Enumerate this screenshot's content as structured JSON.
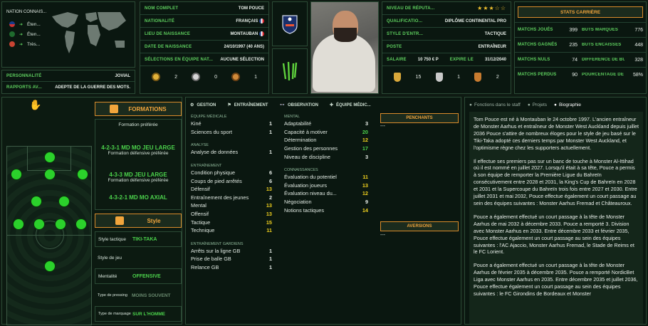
{
  "known_nationalities": {
    "header": "NATION  CONNAIS...",
    "items": [
      {
        "flag": "us",
        "label": "Éten..."
      },
      {
        "flag": "sa",
        "label": "Éten..."
      },
      {
        "flag": "other",
        "label": "Très..."
      }
    ]
  },
  "personality": {
    "label": "PERSONNALITÉ",
    "value": "JOVIAL"
  },
  "media": {
    "label": "RAPPORTS AV...",
    "value": "ADEPTE DE LA GUERRE DES MOTS."
  },
  "profile": {
    "full_name": {
      "label": "NOM COMPLET",
      "value": "TOM POUCE"
    },
    "nationality": {
      "label": "NATIONALITÉ",
      "value": "FRANÇAIS"
    },
    "birthplace": {
      "label": "LIEU DE NAISSANCE",
      "value": "MONTAUBAN"
    },
    "birthdate": {
      "label": "DATE DE NAISSANCE",
      "value": "24/10/1997 (40 ANS)"
    },
    "caps": {
      "label": "SÉLECTIONS EN ÉQUIPE NAT...",
      "value": "AUCUNE SÉLECTION"
    },
    "medals": [
      "2",
      "0",
      "1"
    ]
  },
  "reputation": {
    "level": {
      "label": "NIVEAU DE RÉPUTA...",
      "stars": "★★★☆☆"
    },
    "qualification": {
      "label": "QUALIFICATIO...",
      "value": "DIPLÔME CONTINENTAL PRO"
    },
    "style": {
      "label": "STYLE D'ENTR...",
      "value": "TACTIQUE"
    },
    "position": {
      "label": "POSTE",
      "value": "ENTRAÎNEUR"
    },
    "salary": {
      "label": "SALAIRE",
      "value": "10 750 € P",
      "expiry_label": "EXPIRE LE",
      "expiry": "31/12/2040"
    },
    "trophies": [
      "15",
      "1",
      "2"
    ]
  },
  "career": {
    "title": "STATS CARRIÈRE",
    "rows": [
      {
        "l1": "MATCHS JOUÉS",
        "v1": "399",
        "l2": "BUTS MARQUÉS",
        "v2": "776"
      },
      {
        "l1": "MATCHS GAGNÉS",
        "v1": "235",
        "l2": "BUTS ENCAISSÉS",
        "v2": "448"
      },
      {
        "l1": "MATCHS NULS",
        "v1": "74",
        "l2": "DIFFÉRENCE DE BU...",
        "v2": "328"
      },
      {
        "l1": "MATCHS PERDUS",
        "v1": "90",
        "l2": "POURCENTAGE DE ...",
        "v2": "58%"
      }
    ]
  },
  "formations": {
    "title": "FORMATIONS",
    "preferred_label": "Formation préférée",
    "f1": "4-2-3-1 MD MO JEU LARGE",
    "f1_sub": "Formation défensive préférée",
    "f2": "4-3-3 MD JEU LARGE",
    "f2_sub": "Formation défensive préférée",
    "f3": "4-3-2-1 MD MO AXIAL"
  },
  "style": {
    "title": "Style",
    "tactical_label": "Style tactique",
    "tactical": "TIKI-TAKA",
    "play_label": "Style de jeu",
    "mentality_label": "Mentalité",
    "mentality": "OFFENSIVE",
    "pressing_label": "Type de pressing",
    "pressing": "MOINS SOUVENT",
    "marking_label": "Type de marquage",
    "marking": "SUR L'HOMME"
  },
  "attr_tabs": [
    "GESTION",
    "ENTRAÎNEMENT",
    "OBSERVATION",
    "ÉQUIPE MÉDIC..."
  ],
  "attributes": {
    "medical": {
      "title": "ÉQUIPE MÉDICALE",
      "items": [
        {
          "n": "Kiné",
          "v": "1",
          "c": "w"
        },
        {
          "n": "Sciences du sport",
          "v": "1",
          "c": "w"
        }
      ]
    },
    "analysis": {
      "title": "ANALYSE",
      "items": [
        {
          "n": "Analyse de données",
          "v": "1",
          "c": "w"
        }
      ]
    },
    "coaching": {
      "title": "ENTRAÎNEMENT",
      "items": [
        {
          "n": "Condition physique",
          "v": "6",
          "c": "w"
        },
        {
          "n": "Coups de pied arrêtés",
          "v": "6",
          "c": "w"
        },
        {
          "n": "Défensif",
          "v": "13",
          "c": "y"
        },
        {
          "n": "Entraînement des jeunes",
          "v": "2",
          "c": "w"
        },
        {
          "n": "Mental",
          "v": "13",
          "c": "y"
        },
        {
          "n": "Offensif",
          "v": "13",
          "c": "y"
        },
        {
          "n": "Tactique",
          "v": "15",
          "c": "y"
        },
        {
          "n": "Technique",
          "v": "11",
          "c": "y"
        }
      ]
    },
    "gk": {
      "title": "ENTRAÎNEMENT GARDIENS",
      "items": [
        {
          "n": "Arrêts sur la ligne GB",
          "v": "1",
          "c": "w"
        },
        {
          "n": "Prise de balle GB",
          "v": "1",
          "c": "w"
        },
        {
          "n": "Relance GB",
          "v": "1",
          "c": "w"
        }
      ]
    },
    "mental": {
      "title": "MENTAL",
      "items": [
        {
          "n": "Adaptabilité",
          "v": "3",
          "c": "w"
        },
        {
          "n": "Capacité à motiver",
          "v": "20",
          "c": "g"
        },
        {
          "n": "Détermination",
          "v": "12",
          "c": "y"
        },
        {
          "n": "Gestion des personnes",
          "v": "17",
          "c": "g"
        },
        {
          "n": "Niveau de discipline",
          "v": "3",
          "c": "w"
        }
      ]
    },
    "knowledge": {
      "title": "CONNAISSANCES",
      "items": [
        {
          "n": "Évaluation du potentiel",
          "v": "11",
          "c": "y"
        },
        {
          "n": "Évaluation joueurs",
          "v": "13",
          "c": "y"
        },
        {
          "n": "Évaluation niveau du...",
          "v": "12",
          "c": "y"
        },
        {
          "n": "Négociation",
          "v": "9",
          "c": "w"
        },
        {
          "n": "Notions tactiques",
          "v": "14",
          "c": "y"
        }
      ]
    }
  },
  "likes": {
    "title": "PENCHANTS",
    "value": "---"
  },
  "dislikes": {
    "title": "AVERSIONS",
    "value": "---"
  },
  "bio_tabs": [
    "Fonctions dans le staff",
    "Projets",
    "Biographie"
  ],
  "bio": [
    "Tom Pouce est né à Montauban le 24 octobre 1997. L'ancien entraîneur de Monster Aarhus et entraîneur de Monster West Auckland depuis juillet 2036 Pouce s'attire de nombreux éloges pour le style de jeu basé sur le Tiki-Taka adopté ces derniers temps par Monster West Auckland, et l'optimisme règne chez les supporters actuellement.",
    "Il effectue ses premiers pas sur un banc de touche à Monster Al-Ittihad où il est nommé en juillet 2027. Lorsqu'il était à sa tête, Pouce a permis à son équipe de remporter la Première Ligue du Bahreïn consécutivement entre 2028 et 2031, la King's Cup de Bahreïn en 2028 et 2031 et la Supercoupe du Bahreïn trois fois entre 2027 et 2030. Entre juillet 2031 et mai 2032, Pouce effectue également un court passage au sein des équipes suivantes : Monster Aarhus Fremad et Châteauroux.",
    "Pouce a également effectué un court passage à la tête de Monster Aarhus de mai 2032 à décembre 2033. Pouce a remporté 3. Division avec Monster Aarhus en 2033. Entre décembre 2033 et février 2035, Pouce effectue également un court passage au sein des équipes suivantes : l'AC Ajaccio, Monster Aarhus Fremad, le Stade de Reims et le FC Lorient.",
    "Pouce a également effectué un court passage à la tête de Monster Aarhus de février 2035 à décembre 2035. Pouce a remporté NordicBet Liga avec Monster Aarhus en 2035. Entre décembre 2035 et juillet 2036, Pouce effectue également un court passage au sein des équipes suivantes : le FC Girondins de Bordeaux et Monster"
  ]
}
